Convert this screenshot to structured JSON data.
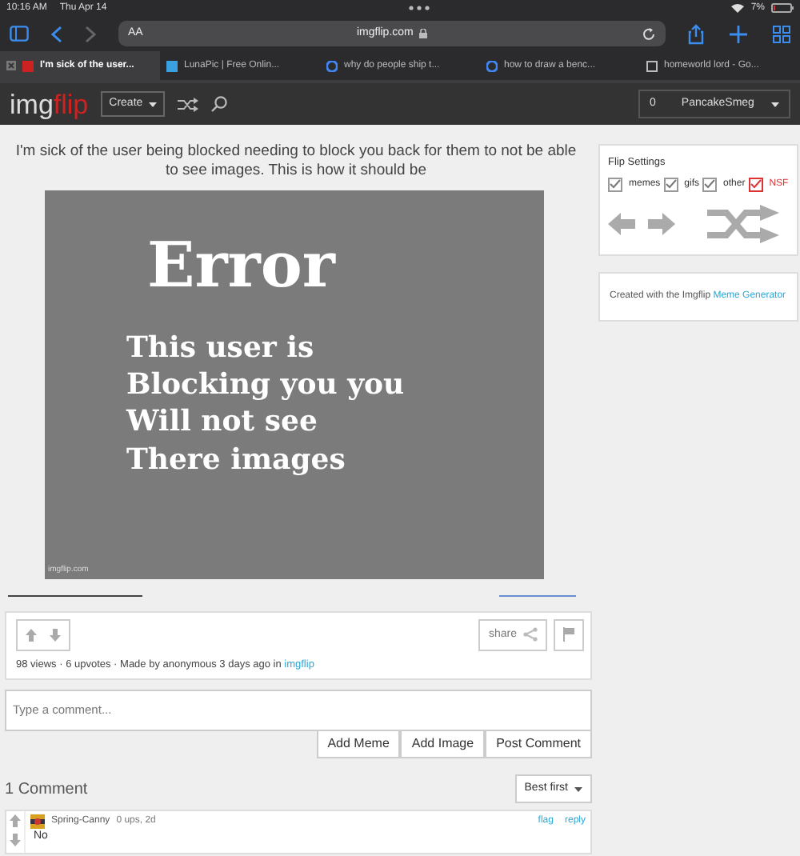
{
  "status_bar": {
    "time": "10:16 AM",
    "date": "Thu Apr 14",
    "battery": "7%"
  },
  "browser": {
    "text_size": "AA",
    "address": "imgflip.com",
    "tabs": [
      {
        "title": "I'm sick of the user...",
        "selected": true
      },
      {
        "title": "LunaPic | Free Onlin...",
        "selected": false
      },
      {
        "title": "why do people ship t...",
        "selected": false
      },
      {
        "title": "how to draw a benc...",
        "selected": false
      },
      {
        "title": "homeworld lord - Go...",
        "selected": false
      }
    ]
  },
  "site_nav": {
    "logo_a": "img",
    "logo_b": "flip",
    "create": "Create",
    "notifications": "0",
    "user": "PancakeSmeg"
  },
  "post": {
    "title": "I'm sick of the user being blocked needing to block you back for them to not be able to see images. This is how it should be",
    "meme": {
      "heading": "Error",
      "lines": [
        "This user is",
        "Blocking you you",
        "Will not see",
        "There images"
      ],
      "credit": "imgflip.com"
    },
    "share": "share",
    "stats": "98 views · 6 upvotes · Made by anonymous 3 days ago in ",
    "stream": "imgflip"
  },
  "comment_form": {
    "placeholder": "Type a comment...",
    "buttons": [
      "Add Meme",
      "Add Image",
      "Post Comment"
    ]
  },
  "comments": {
    "count": "1 Comment",
    "sort": "Best first",
    "items": [
      {
        "user": "Spring-Canny",
        "meta": "0 ups, 2d",
        "flag": "flag",
        "reply": "reply",
        "text": "No"
      }
    ]
  },
  "sidebar": {
    "flip_title": "Flip Settings",
    "filters": [
      {
        "label": "memes",
        "checked": true,
        "kind": "normal"
      },
      {
        "label": "gifs",
        "checked": true,
        "kind": "normal"
      },
      {
        "label": "other",
        "checked": true,
        "kind": "normal"
      },
      {
        "label": "NSF",
        "checked": true,
        "kind": "nsfw"
      }
    ],
    "created": "Created with the Imgflip ",
    "created_link": "Meme Generator"
  }
}
